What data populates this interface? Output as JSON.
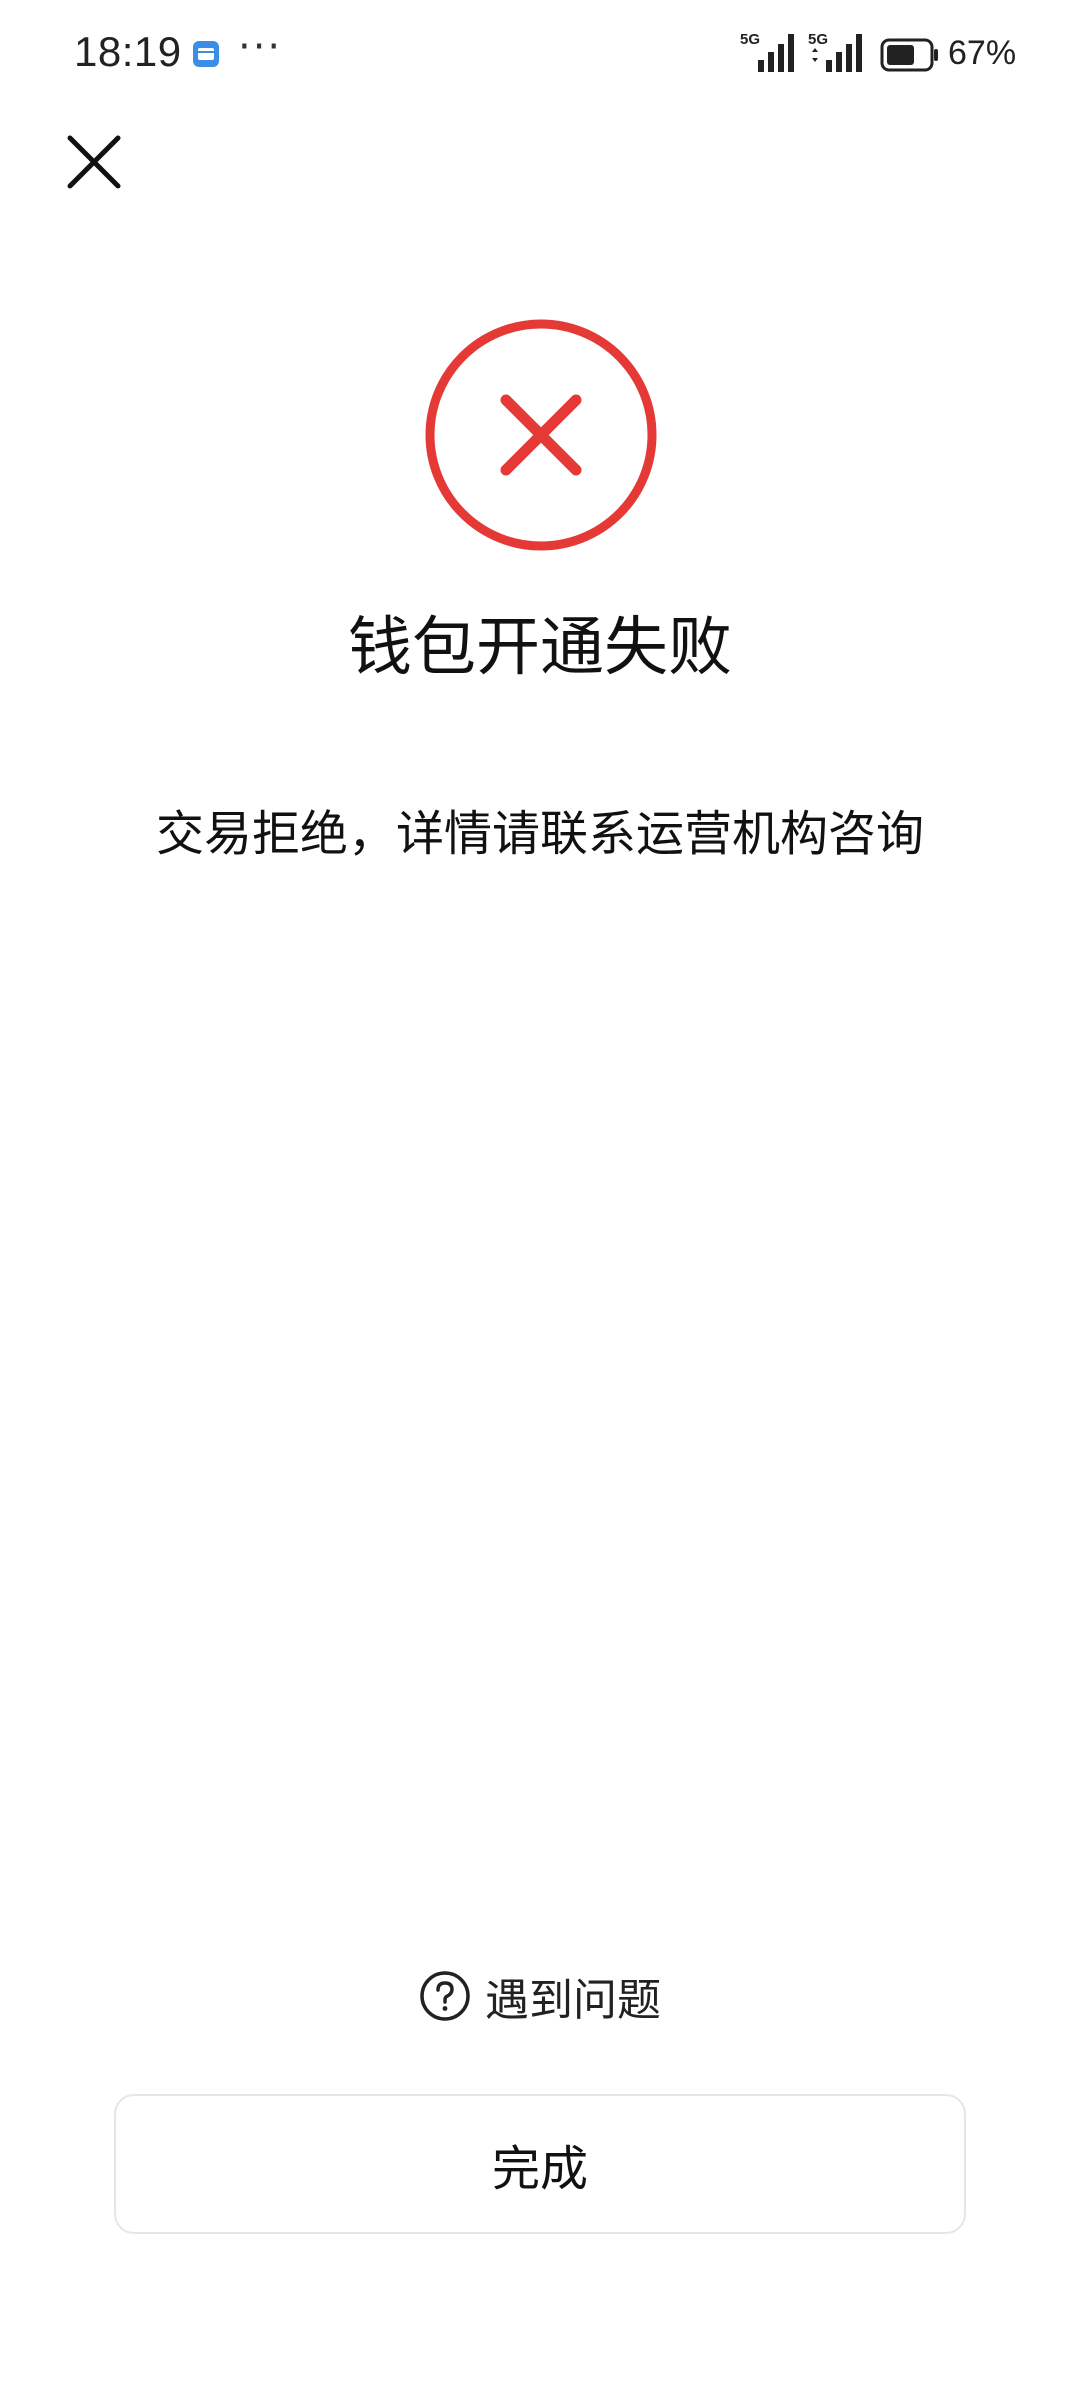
{
  "status_bar": {
    "time": "18:19",
    "more": "···",
    "signal_1_label": "5G",
    "signal_2_label": "5G",
    "battery_percent": "67%",
    "battery_level": 0.67
  },
  "colors": {
    "error_red": "#e53935",
    "text": "#111111",
    "border": "#e6e6e6",
    "notif_blue": "#3a8ee6"
  },
  "header": {
    "close_icon": "close-icon"
  },
  "result": {
    "icon": "error-circle-icon",
    "title": "钱包开通失败",
    "message": "交易拒绝，详情请联系运营机构咨询"
  },
  "footer": {
    "help_icon": "question-circle-icon",
    "help_label": "遇到问题",
    "done_label": "完成"
  }
}
